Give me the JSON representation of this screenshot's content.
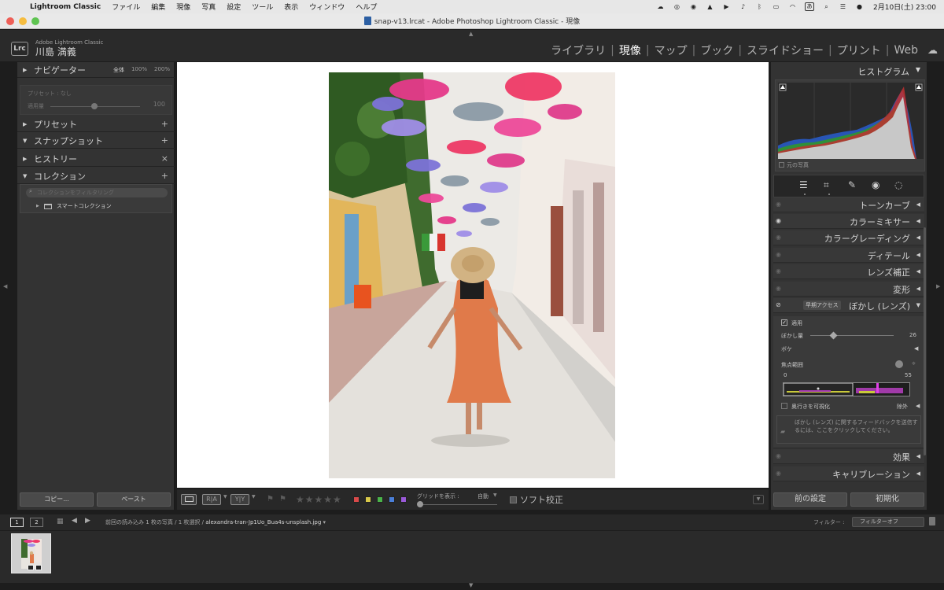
{
  "menubar": {
    "app_name": "Lightroom Classic",
    "items": [
      "ファイル",
      "編集",
      "現像",
      "写真",
      "設定",
      "ツール",
      "表示",
      "ウィンドウ",
      "ヘルプ"
    ],
    "ime_label": "あ",
    "clock": "2月10日(土)  23:00"
  },
  "window": {
    "title": "snap-v13.lrcat - Adobe Photoshop Lightroom Classic - 現像"
  },
  "identity": {
    "product": "Adobe Lightroom Classic",
    "user": "川島 満義",
    "logo": "Lrc"
  },
  "modules": {
    "library": "ライブラリ",
    "develop": "現像",
    "map": "マップ",
    "book": "ブック",
    "slideshow": "スライドショー",
    "print": "プリント",
    "web": "Web",
    "active": "現像"
  },
  "left_panel": {
    "navigator": {
      "label": "ナビゲーター",
      "fit": "全体",
      "zoom1": "100%",
      "zoom2": "200%"
    },
    "preset_box": {
      "preset_line": "プリセット : なし",
      "amount_label": "適用量",
      "amount_value": "100"
    },
    "presets": "プリセット",
    "snapshots": "スナップショット",
    "history": "ヒストリー",
    "collections": "コレクション",
    "collection_search_placeholder": "コレクションをフィルタリング",
    "smart_collection": "スマートコレクション",
    "copy_button": "コピー...",
    "paste_button": "ペースト"
  },
  "toolbar": {
    "view_loupe": "",
    "view_ra": "R|A",
    "view_yy": "Y|Y",
    "stars": "★★★★★",
    "swatch_colors": [
      "#d94a4a",
      "#d9c94a",
      "#4ab34a",
      "#4a7fd9",
      "#9a5ad9"
    ],
    "grid_label": "グリッドを表示 :",
    "grid_value": "自動",
    "soft_proof": "ソフト校正"
  },
  "right_panel": {
    "histogram": "ヒストグラム",
    "original_photo": "元の写真",
    "tone_curve": "トーンカーブ",
    "color_mixer": "カラーミキサー",
    "color_grading": "カラーグレーディング",
    "detail": "ディテール",
    "lens_correction": "レンズ補正",
    "transform": "変形",
    "early_access": "早期アクセス",
    "lens_blur": "ぼかし (レンズ)",
    "apply": "適用",
    "blur_amount_label": "ぼかし量",
    "blur_amount_value": "26",
    "bokeh": "ボケ",
    "focus_range": "焦点範囲",
    "focus_min": "0",
    "focus_max": "55",
    "visualize_depth": "奥行きを可視化",
    "exclude": "除外",
    "feedback": "ぼかし (レンズ) に関するフィードバックを送信するには、ここをクリックしてください。",
    "effects": "効果",
    "calibration": "キャリブレーション",
    "previous_button": "前の設定",
    "reset_button": "初期化"
  },
  "filmstrip_bar": {
    "screen1": "1",
    "screen2": "2",
    "source_prefix": "前回の読み込み   1 枚の写真 / 1 枚選択 /",
    "filename": "alexandra-tran-Jp1Uo_Bua4s-unsplash.jpg",
    "filter_label": "フィルター :",
    "filter_value": "フィルターオフ"
  }
}
